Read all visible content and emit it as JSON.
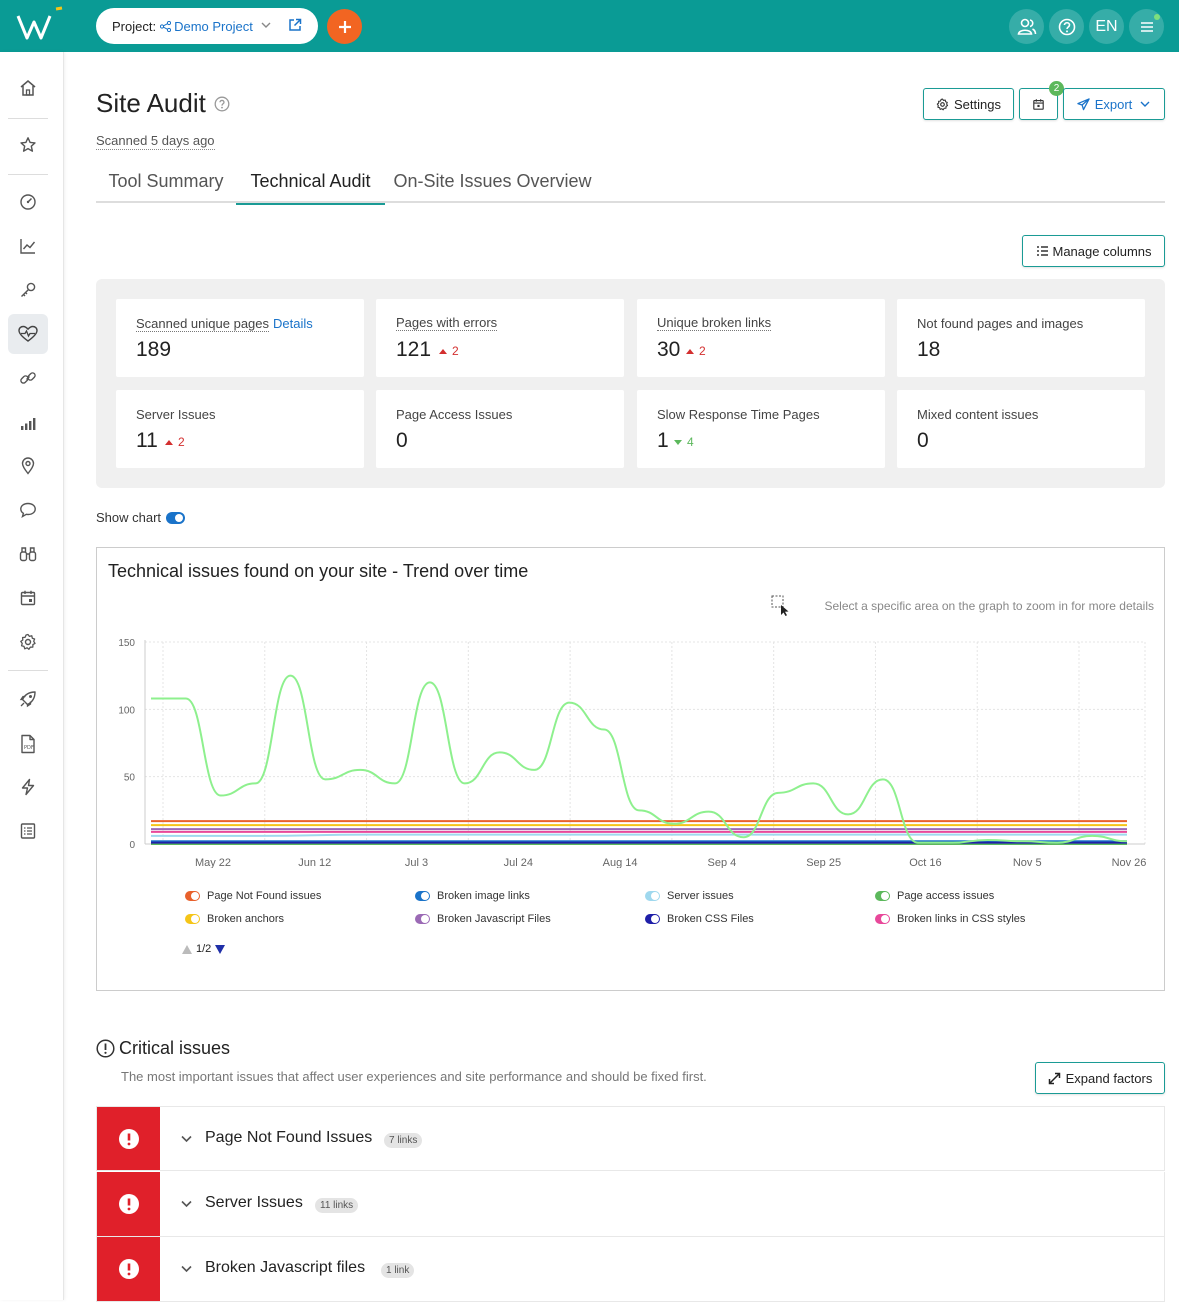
{
  "topbar": {
    "project_label": "Project:",
    "project_name": "Demo Project",
    "lang": "EN"
  },
  "header": {
    "title": "Site Audit",
    "scanned": "Scanned 5 days ago",
    "settings_label": "Settings",
    "export_label": "Export",
    "calendar_badge": "2"
  },
  "tabs": [
    {
      "label": "Tool Summary"
    },
    {
      "label": "Technical Audit"
    },
    {
      "label": "On-Site Issues Overview"
    }
  ],
  "manage_columns_label": "Manage columns",
  "stats": [
    {
      "label": "Scanned unique pages",
      "link": "Details",
      "value": "189"
    },
    {
      "label": "Pages with errors",
      "value": "121",
      "delta": "2",
      "dir": "up"
    },
    {
      "label": "Unique broken links",
      "value": "30",
      "delta": "2",
      "dir": "up"
    },
    {
      "label": "Not found pages and images",
      "value": "18"
    },
    {
      "label": "Server Issues",
      "value": "11",
      "delta": "2",
      "dir": "up"
    },
    {
      "label": "Page Access Issues",
      "value": "0"
    },
    {
      "label": "Slow Response Time Pages",
      "value": "1",
      "delta": "4",
      "dir": "down"
    },
    {
      "label": "Mixed content issues",
      "value": "0"
    }
  ],
  "show_chart_label": "Show chart",
  "chart": {
    "title": "Technical issues found on your site - Trend over time",
    "zoom_hint": "Select a specific area on the graph to zoom in for more details",
    "pager": "1/2"
  },
  "chart_data": {
    "type": "line",
    "x_labels": [
      "May 22",
      "Jun 12",
      "Jul 3",
      "Jul 24",
      "Aug 14",
      "Sep 4",
      "Sep 25",
      "Oct 16",
      "Nov 5",
      "Nov 26"
    ],
    "ylim": [
      0,
      150
    ],
    "yticks": [
      0,
      50,
      100,
      150
    ],
    "series": [
      {
        "name": "Page Not Found issues",
        "color": "#e8612c",
        "values": [
          17,
          17,
          17,
          17,
          17,
          17,
          17,
          17,
          17,
          17
        ]
      },
      {
        "name": "Broken image links",
        "color": "#1a73c9",
        "values": [
          2,
          2,
          2,
          2,
          2,
          2,
          2,
          2,
          2,
          2
        ]
      },
      {
        "name": "Server issues",
        "color": "#9fd8ee",
        "values": [
          6,
          6,
          7,
          7,
          7,
          7,
          7,
          7,
          7,
          7
        ]
      },
      {
        "name": "Page access issues",
        "color": "#5cb85c",
        "values": [
          0,
          0,
          0,
          0,
          0,
          0,
          0,
          0,
          0,
          0
        ]
      },
      {
        "name": "Broken anchors",
        "color": "#f5c518",
        "values": [
          14,
          14,
          14,
          14,
          14,
          14,
          14,
          14,
          14,
          14
        ]
      },
      {
        "name": "Broken Javascript Files",
        "color": "#9b6ab5",
        "values": [
          11,
          11,
          11,
          11,
          11,
          11,
          11,
          11,
          11,
          11
        ]
      },
      {
        "name": "Broken CSS Files",
        "color": "#1f1fa8",
        "values": [
          1,
          1,
          1,
          1,
          1,
          1,
          1,
          1,
          1,
          1
        ]
      },
      {
        "name": "Broken links in CSS styles",
        "color": "#e8489a",
        "values": [
          9,
          9,
          9,
          9,
          9,
          9,
          9,
          9,
          9,
          9
        ]
      },
      {
        "name": "",
        "color": "#8ef08e",
        "values": [
          108,
          108,
          36,
          45,
          125,
          48,
          55,
          45,
          120,
          45,
          68,
          55,
          105,
          85,
          25,
          15,
          24,
          5,
          38,
          45,
          22,
          48,
          1,
          1,
          3,
          2,
          1,
          6,
          2
        ]
      }
    ]
  },
  "critical": {
    "title": "Critical issues",
    "description": "The most important issues that affect user experiences and site performance and should be fixed first.",
    "expand_label": "Expand factors",
    "items": [
      {
        "title": "Page Not Found Issues",
        "badge": "7 links"
      },
      {
        "title": "Server Issues",
        "badge": "11 links"
      },
      {
        "title": "Broken Javascript files",
        "badge": "1 link"
      }
    ]
  }
}
